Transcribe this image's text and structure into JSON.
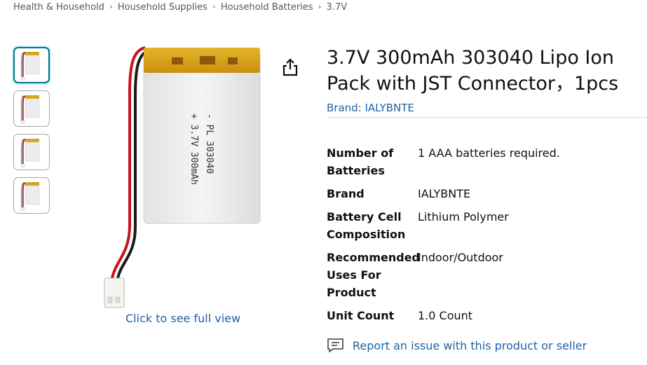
{
  "breadcrumb": {
    "items": [
      "Health & Household",
      "Household Supplies",
      "Household Batteries",
      "3.7V"
    ],
    "separator": "›"
  },
  "product": {
    "title": "3.7V 300mAh 303040 Lipo Ion Pack with JST Connector，1pcs",
    "brand_link": "Brand: IALYBNTE",
    "battery_label_text": [
      "- PL 303040",
      "+ 3.7V 300mAh"
    ]
  },
  "gallery": {
    "thumbnail_count": 4,
    "selected_index": 0,
    "view_full_label": "Click to see full view"
  },
  "specs": [
    {
      "label": "Number of Batteries",
      "value": "1 AAA batteries required."
    },
    {
      "label": "Brand",
      "value": "IALYBNTE"
    },
    {
      "label": "Battery Cell Composition",
      "value": "Lithium Polymer"
    },
    {
      "label": "Recommended Uses For Product",
      "value": "Indoor/Outdoor"
    },
    {
      "label": "Unit Count",
      "value": "1.0 Count"
    }
  ],
  "report": {
    "label": "Report an issue with this product or seller"
  },
  "icons": {
    "share": "share-icon",
    "report": "report-comment-icon"
  },
  "colors": {
    "link": "#2162a1",
    "text": "#0f1111",
    "muted": "#565959",
    "selected_border": "#007185"
  }
}
